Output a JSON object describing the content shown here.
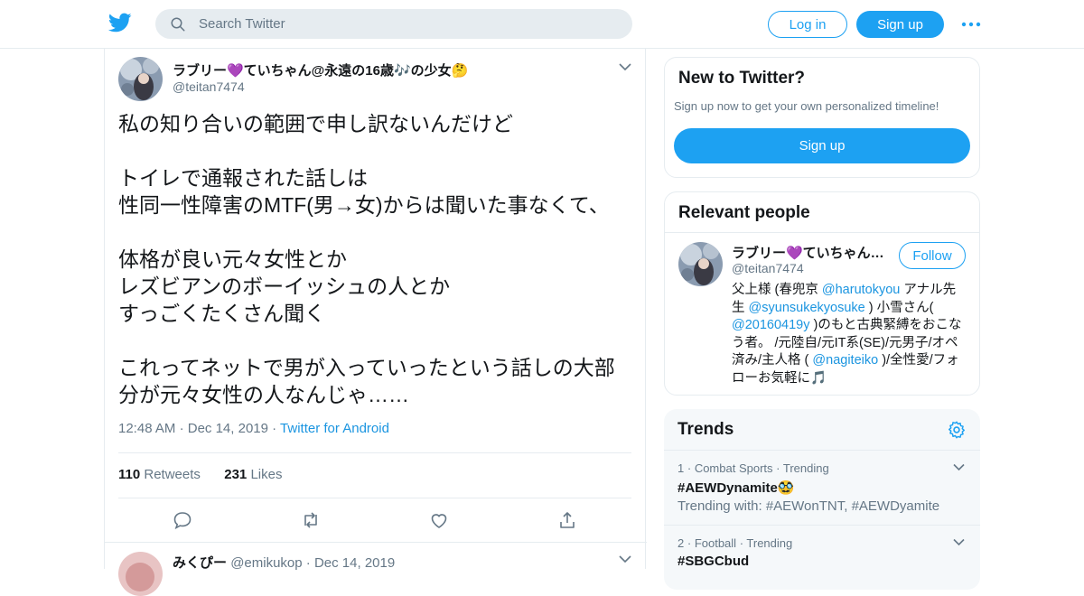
{
  "header": {
    "search_placeholder": "Search Twitter",
    "login_label": "Log in",
    "signup_label": "Sign up",
    "brand_color": "#1da1f2"
  },
  "tweet": {
    "author_name": "ラブリー💜ていちゃん@永遠の16歳🎶の少女🤔",
    "author_handle": "@teitan7474",
    "text": "私の知り合いの範囲で申し訳ないんだけど\n\nトイレで通報された話しは\n性同一性障害のMTF(男→女)からは聞いた事なくて、\n\n体格が良い元々女性とか\nレズビアンのボーイッシュの人とか\nすっごくたくさん聞く\n\nこれってネットで男が入っていったという話しの大部分が元々女性の人なんじゃ……",
    "time": "12:48 AM",
    "date": "Dec 14, 2019",
    "source": "Twitter for Android",
    "retweets_count": "110",
    "retweets_label": "Retweets",
    "likes_count": "231",
    "likes_label": "Likes"
  },
  "reply": {
    "author_name": "みくぴー",
    "author_handle": "@emikukop",
    "date": "Dec 14, 2019"
  },
  "new_to_twitter": {
    "title": "New to Twitter?",
    "subtitle": "Sign up now to get your own personalized timeline!",
    "button_label": "Sign up"
  },
  "relevant_people": {
    "title": "Relevant people",
    "name": "ラブリー💜ていちゃん…",
    "handle": "@teitan7474",
    "follow_label": "Follow",
    "bio": {
      "p1": "父上様 (春兜京 ",
      "m1": "@harutokyou",
      "p2": " アナル先生 ",
      "m2": "@syunsukekyosuke",
      "p3": " ) 小雪さん( ",
      "m3": "@20160419y",
      "p4": " )のもと古典緊縛をおこなう者。 /元陸自/元IT系(SE)/元男子/オペ済み/主人格 ( ",
      "m4": "@nagiteiko",
      "p5": " )/全性愛/フォローお気軽に🎵"
    }
  },
  "trends": {
    "title": "Trends",
    "items": [
      {
        "rank": "1",
        "category": "Combat Sports",
        "status": "Trending",
        "name": "#AEWDynamite🥸",
        "with": "Trending with: #AEWonTNT, #AEWDyamite"
      },
      {
        "rank": "2",
        "category": "Football",
        "status": "Trending",
        "name": "#SBGCbud",
        "with": ""
      }
    ]
  }
}
